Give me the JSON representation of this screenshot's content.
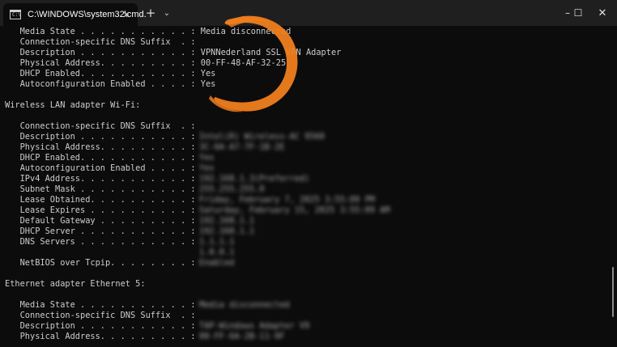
{
  "window": {
    "tab_title": "C:\\WINDOWS\\system32\\cmd.",
    "tab_close": "✕",
    "new_tab": "+",
    "dropdown": "⌄",
    "minimize": "–",
    "maximize": "☐",
    "close": "✕"
  },
  "icons": {
    "tab": "cmd-icon",
    "tab_icon_text": "C:\\"
  },
  "colors": {
    "background": "#0c0c0c",
    "titlebar": "#1f1f1f",
    "text": "#cccccc",
    "accent_brush": "#f07e1e"
  },
  "terminal": {
    "lines": [
      "   Media State . . . . . . . . . . . : Media disconnected",
      "   Connection-specific DNS Suffix  . :",
      "   Description . . . . . . . . . . . : VPNNederland SSL VPN Adapter",
      "   Physical Address. . . . . . . . . : 00-FF-48-AF-32-25",
      "   DHCP Enabled. . . . . . . . . . . : Yes",
      "   Autoconfiguration Enabled . . . . : Yes",
      "",
      "Wireless LAN adapter Wi-Fi:",
      "",
      "   Connection-specific DNS Suffix  . :",
      "   Description . . . . . . . . . . . :",
      "   Physical Address. . . . . . . . . :",
      "   DHCP Enabled. . . . . . . . . . . :",
      "   Autoconfiguration Enabled . . . . :",
      "   IPv4 Address. . . . . . . . . . . :",
      "   Subnet Mask . . . . . . . . . . . :",
      "   Lease Obtained. . . . . . . . . . :",
      "   Lease Expires . . . . . . . . . . :",
      "   Default Gateway . . . . . . . . . :",
      "   DHCP Server . . . . . . . . . . . :",
      "   DNS Servers . . . . . . . . . . . :",
      "",
      "   NetBIOS over Tcpip. . . . . . . . :",
      "",
      "Ethernet adapter Ethernet 5:",
      "",
      "   Media State . . . . . . . . . . . :",
      "   Connection-specific DNS Suffix  . :",
      "   Description . . . . . . . . . . . :",
      "   Physical Address. . . . . . . . . :"
    ],
    "redacted": {
      "wifi_description": "Intel(R) Wireless-AC 9560",
      "wifi_physical": "3C-6A-A7-7F-1B-2E",
      "wifi_dhcp": "Yes",
      "wifi_autoconf": "Yes",
      "wifi_ipv4": "192.168.1.3(Preferred)",
      "wifi_subnet": "255.255.255.0",
      "wifi_lease_obtained": "Friday, February 7, 2025 3:55:09 PM",
      "wifi_lease_expires": "Saturday, February 15, 2025 3:55:09 AM",
      "wifi_gateway": "192.168.1.1",
      "wifi_dhcp_server": "192.168.1.1",
      "wifi_dns_1": "1.1.1.1",
      "wifi_dns_2": "1.0.0.1",
      "wifi_netbios": "Enabled",
      "eth_media_state": "Media disconnected",
      "eth_description": "TAP-Windows Adapter V9",
      "eth_physical": "00-FF-6A-2B-11-9F"
    }
  }
}
